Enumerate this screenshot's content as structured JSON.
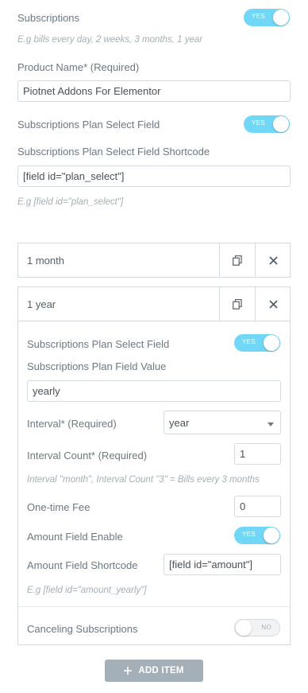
{
  "subscriptions": {
    "label": "Subscriptions",
    "toggle": "YES",
    "hint": "E.g bills every day, 2 weeks, 3 months, 1 year"
  },
  "product_name": {
    "label": "Product Name* (Required)",
    "value": "Piotnet Addons For Elementor"
  },
  "plan_select_field": {
    "label": "Subscriptions Plan Select Field",
    "toggle": "YES"
  },
  "plan_select_shortcode": {
    "label": "Subscriptions Plan Select Field Shortcode",
    "value": "[field id=\"plan_select\"]",
    "hint": "E.g [field id=\"plan_select\"]"
  },
  "repeater": {
    "items": [
      {
        "title": "1 month"
      },
      {
        "title": "1 year"
      }
    ],
    "expanded": {
      "plan_select_field_label": "Subscriptions Plan Select Field",
      "plan_select_toggle": "YES",
      "plan_field_value_label": "Subscriptions Plan Field Value",
      "plan_field_value": "yearly",
      "interval_label": "Interval* (Required)",
      "interval_value": "year",
      "interval_count_label": "Interval Count* (Required)",
      "interval_count_value": "1",
      "interval_hint": "Interval \"month\", Interval Count \"3\" = Bills every 3 months",
      "one_time_fee_label": "One-time Fee",
      "one_time_fee_value": "0",
      "amount_field_enable_label": "Amount Field Enable",
      "amount_field_enable_toggle": "YES",
      "amount_field_shortcode_label": "Amount Field Shortcode",
      "amount_field_shortcode_value": "[field id=\"amount\"]",
      "amount_field_hint": "E.g [field id=\"amount_yearly\"]",
      "canceling_label": "Canceling Subscriptions",
      "canceling_toggle": "NO"
    }
  },
  "add_item": {
    "label": "ADD ITEM"
  },
  "icons": {
    "duplicate": "copy-icon",
    "remove": "close-icon",
    "add": "plus-icon",
    "caret": "chevron-down-icon"
  },
  "colors": {
    "toggle_on": "#71d7f7",
    "button_gray": "#a4afb7",
    "border": "#d5dadf"
  }
}
